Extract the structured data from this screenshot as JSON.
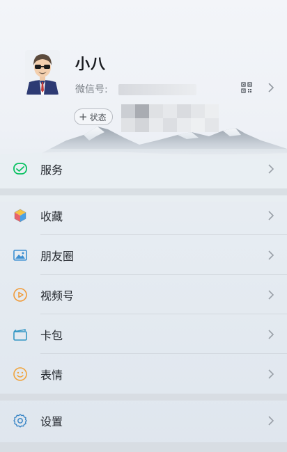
{
  "profile": {
    "nickname": "小八",
    "wechat_id_label": "微信号:",
    "status_label": "状态",
    "status_add_glyph": "+",
    "avatar_icon": "avatar-cartoon-man-sunglasses",
    "qr_icon": "qr-code-icon",
    "chevron_icon": "chevron-right-icon"
  },
  "menu": {
    "services": {
      "label": "服务",
      "icon": "services-icon",
      "color": "#07c160"
    },
    "favorites": {
      "label": "收藏",
      "icon": "favorites-cube-icon"
    },
    "moments": {
      "label": "朋友圈",
      "icon": "moments-photo-icon",
      "color": "#3d8fd1"
    },
    "channels": {
      "label": "视频号",
      "icon": "channels-play-icon",
      "color": "#f09a38"
    },
    "cards": {
      "label": "卡包",
      "icon": "card-wallet-icon",
      "color": "#3396c4"
    },
    "stickers": {
      "label": "表情",
      "icon": "sticker-smile-icon",
      "color": "#f0a33b"
    },
    "settings": {
      "label": "设置",
      "icon": "settings-gear-icon",
      "color": "#3a86c6"
    }
  },
  "colors": {
    "accent_green": "#07c160",
    "text_primary": "#23272d",
    "text_secondary": "#7d8289"
  }
}
